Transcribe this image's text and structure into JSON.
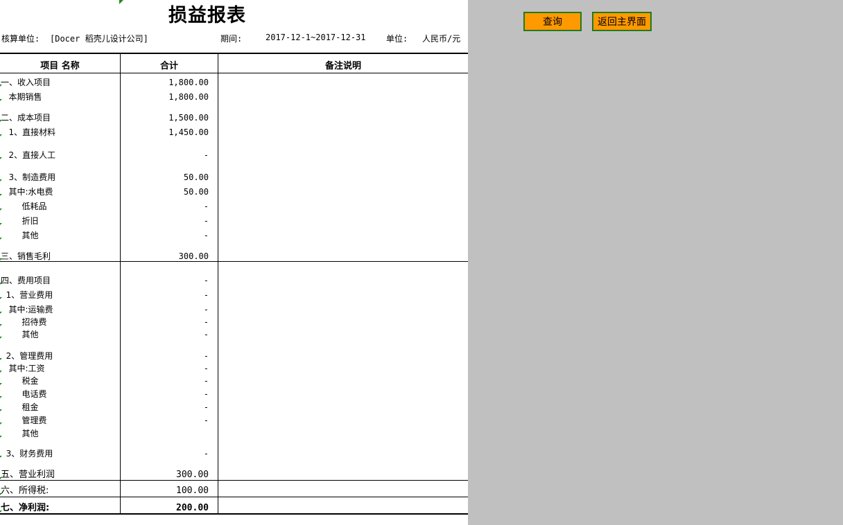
{
  "report": {
    "title": "损益报表",
    "entity_label": "核算单位:",
    "entity_value": "[Docer 稻壳儿设计公司]",
    "period_label": "期间:",
    "period_value": "2017-12-1~2017-12-31",
    "unit_label": "单位:",
    "unit_value": "人民币/元"
  },
  "columns": {
    "name": "项目 名称",
    "total": "合计",
    "note": "备注说明"
  },
  "rows": [
    {
      "label": "一、收入项目",
      "value": "1,800.00"
    },
    {
      "label": "   本期销售",
      "value": "1,800.00"
    },
    {
      "label": "二、成本项目",
      "value": "1,500.00"
    },
    {
      "label": "   1、直接材料",
      "value": "1,450.00"
    },
    {
      "label": "   2、直接人工",
      "value": "-"
    },
    {
      "label": "   3、制造费用",
      "value": "50.00"
    },
    {
      "label": "   其中:水电费",
      "value": "50.00"
    },
    {
      "label": "        低耗品",
      "value": "-"
    },
    {
      "label": "        折旧",
      "value": "-"
    },
    {
      "label": "        其他",
      "value": "-"
    },
    {
      "label": "三、销售毛利",
      "value": "300.00"
    },
    {
      "label": "四、费用项目",
      "value": "-"
    },
    {
      "label": "  1、营业费用",
      "value": "-"
    },
    {
      "label": "   其中:运输费",
      "value": "-"
    },
    {
      "label": "        招待费",
      "value": "-"
    },
    {
      "label": "        其他",
      "value": "-"
    },
    {
      "label": "  2、管理费用",
      "value": "-"
    },
    {
      "label": "   其中:工资",
      "value": "-"
    },
    {
      "label": "        税金",
      "value": "-"
    },
    {
      "label": "        电话费",
      "value": "-"
    },
    {
      "label": "        租金",
      "value": "-"
    },
    {
      "label": "        管理费",
      "value": "-"
    },
    {
      "label": "        其他",
      "value": ""
    },
    {
      "label": "  3、财务费用",
      "value": "-"
    },
    {
      "label": "五、营业利润",
      "value": "300.00"
    },
    {
      "label": "六、所得税:",
      "value": "100.00"
    },
    {
      "label": "七、净利润:",
      "value": "200.00"
    }
  ],
  "buttons": {
    "query": "查询",
    "home": "返回主界面"
  }
}
